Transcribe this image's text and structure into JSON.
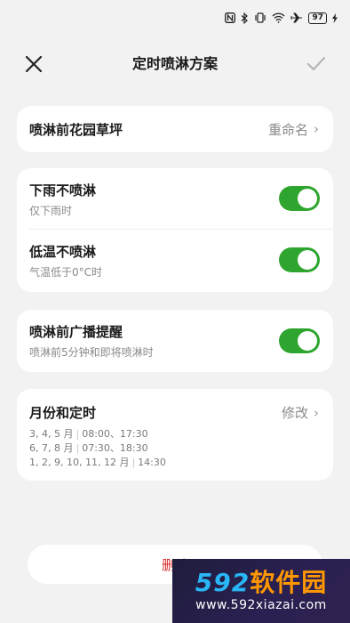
{
  "status_bar": {
    "icons": [
      "nfc-icon",
      "bluetooth-icon",
      "vibrate-icon",
      "wifi-icon",
      "airplane-icon"
    ],
    "battery": "97"
  },
  "header": {
    "title": "定时喷淋方案",
    "close_icon": "close-icon",
    "confirm_icon": "check-icon"
  },
  "plan": {
    "name": "喷淋前花园草坪",
    "rename_label": "重命名"
  },
  "rules": [
    {
      "title": "下雨不喷淋",
      "subtitle": "仅下雨时",
      "enabled": true
    },
    {
      "title": "低温不喷淋",
      "subtitle": "气温低于0°C时",
      "enabled": true
    }
  ],
  "reminder": {
    "title": "喷淋前广播提醒",
    "subtitle": "喷淋前5分钟和即将喷淋时",
    "enabled": true
  },
  "schedule": {
    "title": "月份和定时",
    "edit_label": "修改",
    "lines": [
      {
        "months": "3, 4, 5 月",
        "times": "08:00、17:30"
      },
      {
        "months": "6, 7, 8 月",
        "times": "07:30、18:30"
      },
      {
        "months": "1, 2, 9, 10, 11, 12 月",
        "times": "14:30"
      }
    ]
  },
  "delete_label": "删除",
  "watermark": {
    "brand_num": "592",
    "brand_cn": "软件园",
    "url": "www.592xiazai.com"
  },
  "colors": {
    "toggle_on": "#2ea52e",
    "delete_text": "#d92a2a",
    "background": "#f2f2f2"
  }
}
